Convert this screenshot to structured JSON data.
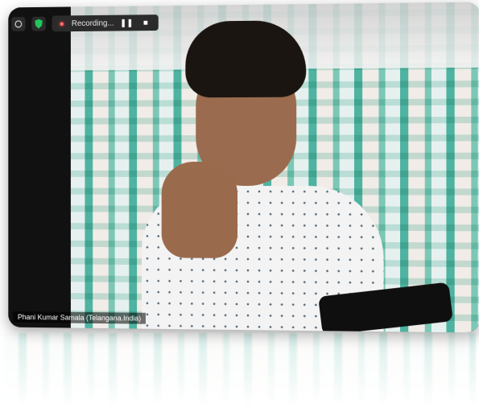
{
  "toolbar": {
    "recording_label": "Recording...",
    "pause_symbol": "❚❚",
    "stop_symbol": "■"
  },
  "participant": {
    "name_label": "Phani Kumar Samala (Telangana.India)"
  },
  "colors": {
    "accent_green": "#22c55e",
    "record_red": "#ff6b6b"
  },
  "icons": {
    "security": "shield-icon",
    "record": "record-dot-icon",
    "pause": "pause-icon",
    "stop": "stop-icon"
  }
}
